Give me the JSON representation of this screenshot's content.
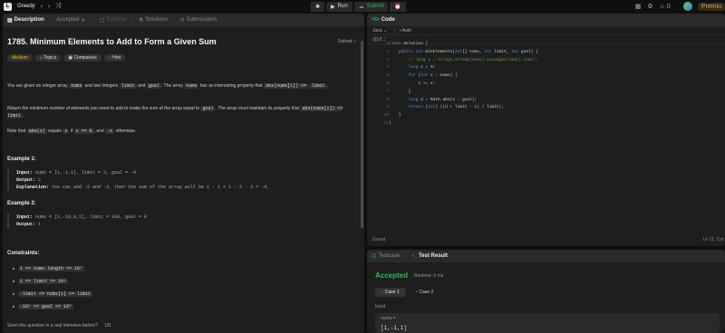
{
  "topbar": {
    "title": "Greedy",
    "run_label": "Run",
    "submit_label": "Submit",
    "premium_label": "Premiu",
    "notif_count": "0"
  },
  "left_tabs": [
    "Description",
    "Accepted",
    "Editorial",
    "Solutions",
    "Submissions"
  ],
  "problem": {
    "title": "1785. Minimum Elements to Add to Form a Given Sum",
    "solved_label": "Solved",
    "chips": [
      "Medium",
      "Topics",
      "Companies",
      "Hint"
    ],
    "p1_a": "You are given an integer array",
    "p1_nums": "nums",
    "p1_b": "and two integers",
    "p1_limit": "limit",
    "p1_c": "and",
    "p1_goal": "goal",
    "p1_d": ". The array",
    "p1_nums2": "nums",
    "p1_e": "has an interesting property that",
    "p1_abs": "abs(nums[i]) <=",
    "p1_limit2": "limit",
    "p1_f": ".",
    "p2_a": "Return the minimum number of elements you need to add to make the sum of the array equal to",
    "p2_goal": "goal",
    "p2_b": ". The array must maintain its property",
    "p2_c": "that",
    "p2_abs": "abs(nums[i]) <= limit",
    "p2_d": ".",
    "p3_a": "Note that",
    "p3_absx": "abs(x)",
    "p3_b": "equals",
    "p3_x": "x",
    "p3_c": "if",
    "p3_cond": "x >= 0",
    "p3_d": ", and",
    "p3_negx": "-x",
    "p3_e": "otherwise.",
    "ex1_heading": "Example 1:",
    "ex1_input_label": "Input:",
    "ex1_input": "nums = [1,-1,1], limit = 3, goal = -4",
    "ex1_output_label": "Output:",
    "ex1_output": "2",
    "ex1_expl_label": "Explanation:",
    "ex1_expl": "You can add -2 and -3, then the sum of the array will be 1 - 1 + 1 - 2 - 3 = -4.",
    "ex2_heading": "Example 2:",
    "ex2_input_label": "Input:",
    "ex2_input": "nums = [1,-10,9,1], limit = 100, goal = 0",
    "ex2_output_label": "Output:",
    "ex2_output": "1",
    "constraints_heading": "Constraints:",
    "constraints": [
      "1 <= nums.length <= 10⁵",
      "1 <= limit <= 10⁶",
      "-limit <= nums[i] <= limit",
      "-10⁹ <= goal <= 10⁹"
    ],
    "footer_q": "Seen this question in a real interview before?",
    "footer_count": "1/5"
  },
  "code": {
    "tab_label": "Code",
    "language": "Java",
    "mode": "Auto",
    "line_numbers": [
      "1",
      "2",
      "3",
      "4",
      "5",
      "6",
      "7",
      "8",
      "9",
      "10",
      "11"
    ],
    "saved": "Saved",
    "cursor": "Ln 11, Col"
  },
  "test": {
    "tab_testcase": "Testcase",
    "tab_result": "Test Result",
    "status": "Accepted",
    "runtime": "Runtime: 0 ms",
    "cases": [
      "Case 1",
      "Case 2"
    ],
    "input_label": "Input",
    "input_key": "nums =",
    "input_value": "[1,-1,1]"
  },
  "colors": {
    "accent_green": "#2cbb5d",
    "medium": "#ffb800",
    "premium": "#ffa116"
  }
}
